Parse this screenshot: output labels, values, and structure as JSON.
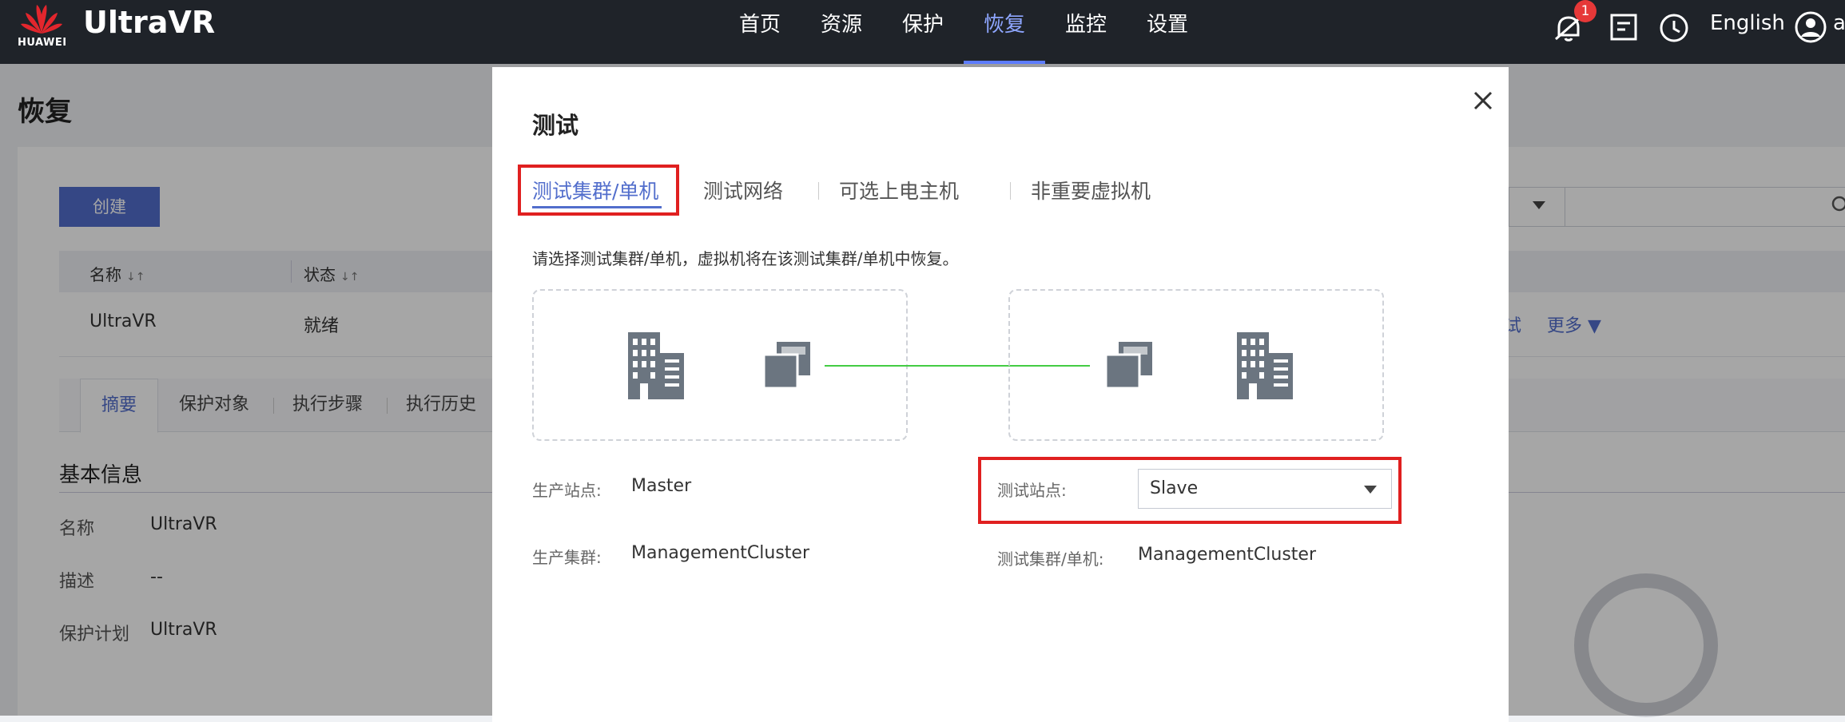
{
  "header": {
    "logo_text": "HUAWEI",
    "brand": "UltraVR",
    "nav": [
      "首页",
      "资源",
      "保护",
      "恢复",
      "监控",
      "设置"
    ],
    "active_nav_index": 3,
    "notification_count": "1",
    "language": "English",
    "user_initial": "a"
  },
  "page": {
    "title": "恢复",
    "create_button": "创建",
    "table": {
      "columns": [
        "名称",
        "状态"
      ],
      "rows": [
        {
          "name": "UltraVR",
          "status": "就绪"
        }
      ],
      "row_actions": [
        "试",
        "更多"
      ]
    },
    "sub_tabs": [
      "摘要",
      "保护对象",
      "执行步骤",
      "执行历史"
    ],
    "active_sub_tab_index": 0,
    "section_title": "基本信息",
    "info": [
      {
        "label": "名称",
        "value": "UltraVR"
      },
      {
        "label": "描述",
        "value": "--"
      },
      {
        "label": "保护计划",
        "value": "UltraVR"
      }
    ]
  },
  "modal": {
    "title": "测试",
    "tabs": [
      "测试集群/单机",
      "测试网络",
      "可选上电主机",
      "非重要虚拟机"
    ],
    "active_tab_index": 0,
    "description": "请选择测试集群/单机，虚拟机将在该测试集群/单机中恢复。",
    "production_site_label": "生产站点:",
    "production_site_value": "Master",
    "production_cluster_label": "生产集群:",
    "production_cluster_value": "ManagementCluster",
    "test_site_label": "测试站点:",
    "test_site_value": "Slave",
    "test_cluster_label": "测试集群/单机:",
    "test_cluster_value": "ManagementCluster"
  },
  "colors": {
    "topbar": "#1f2329",
    "accent": "#526ecc",
    "highlight": "#e02020",
    "link_line": "#44cc44",
    "icon_gray": "#6b7580"
  }
}
